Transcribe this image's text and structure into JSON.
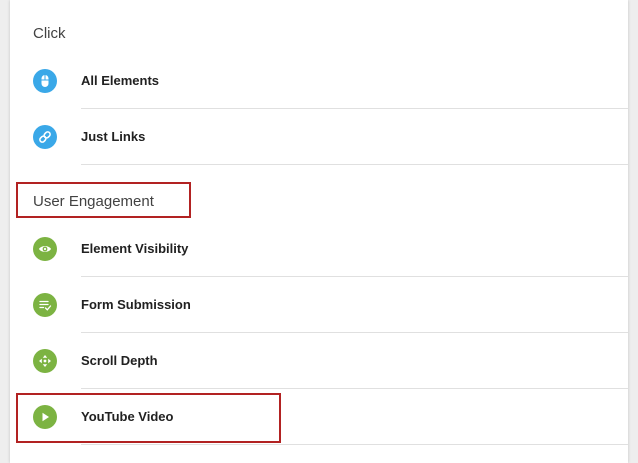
{
  "colors": {
    "click_icon_bg": "#3aa8e8",
    "engagement_icon_bg": "#7cb342",
    "highlight_border": "#b22222"
  },
  "sections": {
    "click": {
      "title": "Click",
      "items": [
        {
          "label": "All Elements",
          "icon": "mouse-icon"
        },
        {
          "label": "Just Links",
          "icon": "link-icon"
        }
      ]
    },
    "engagement": {
      "title": "User Engagement",
      "items": [
        {
          "label": "Element Visibility",
          "icon": "eye-icon"
        },
        {
          "label": "Form Submission",
          "icon": "form-check-icon"
        },
        {
          "label": "Scroll Depth",
          "icon": "move-arrows-icon"
        },
        {
          "label": "YouTube Video",
          "icon": "play-icon"
        }
      ]
    }
  }
}
